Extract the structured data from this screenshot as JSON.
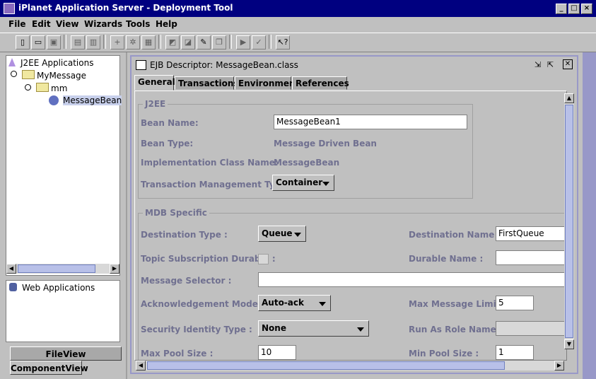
{
  "window": {
    "title": "iPlanet Application Server - Deployment Tool"
  },
  "menu": [
    "File",
    "Edit",
    "View",
    "Wizards",
    "Tools",
    "Help"
  ],
  "tree": {
    "root": "J2EE Applications",
    "app": "MyMessage",
    "module": "mm",
    "bean": "MessageBean"
  },
  "web": {
    "label": "Web Applications"
  },
  "bottom_tabs": {
    "file_view": "FileView",
    "component_view": "ComponentView"
  },
  "inner": {
    "title": "EJB Descriptor: MessageBean.class",
    "tabs": [
      "General",
      "Transactions",
      "Environment",
      "References"
    ]
  },
  "j2ee": {
    "group_title": "J2EE",
    "bean_name_label": "Bean Name:",
    "bean_name_value": "MessageBean1",
    "bean_type_label": "Bean Type:",
    "bean_type_value": "Message Driven Bean",
    "impl_label": "Implementation Class Name:",
    "impl_value": "MessageBean",
    "tx_label": "Transaction Management Type :",
    "tx_value": "Container"
  },
  "mdb": {
    "group_title": "MDB Specific",
    "dest_type_label": "Destination Type :",
    "dest_type_value": "Queue",
    "dest_name_label": "Destination Name :",
    "dest_name_value": "FirstQueue",
    "topic_label": "Topic Subscription Durable :",
    "durable_name_label": "Durable Name :",
    "durable_name_value": "",
    "selector_label": "Message Selector :",
    "selector_value": "",
    "ack_label": "Acknowledgement Mode :",
    "ack_value": "Auto-ack",
    "max_msg_label": "Max Message Limit :",
    "max_msg_value": "5",
    "sec_label": "Security Identity Type :",
    "sec_value": "None",
    "run_as_label": "Run As Role Name :",
    "run_as_value": "",
    "max_pool_label": "Max Pool Size :",
    "max_pool_value": "10",
    "min_pool_label": "Min Pool Size :",
    "min_pool_value": "1"
  }
}
